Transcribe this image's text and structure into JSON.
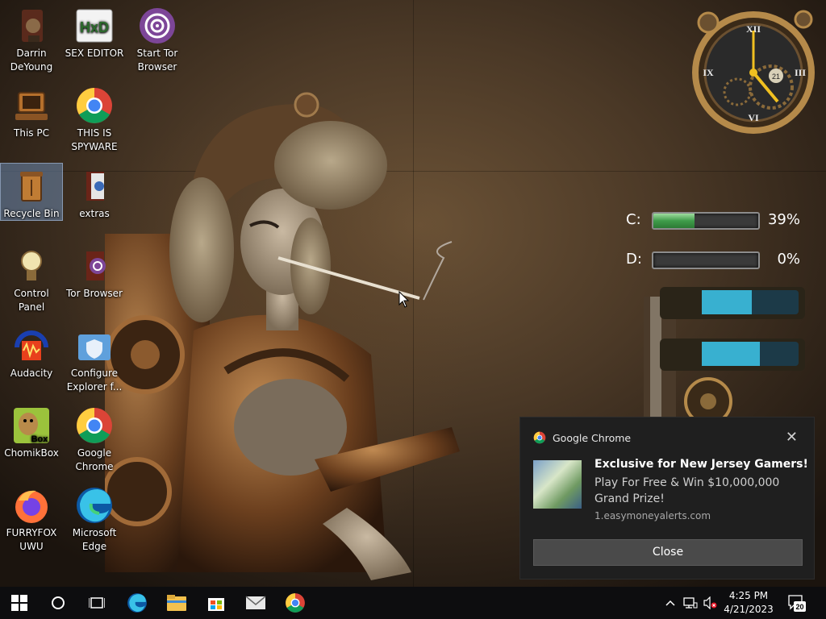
{
  "desktop": {
    "icons": [
      {
        "label": "Darrin DeYoung"
      },
      {
        "label": "SEX EDITOR"
      },
      {
        "label": "Start Tor Browser"
      },
      {
        "label": "This PC"
      },
      {
        "label": "THIS IS SPYWARE"
      },
      {
        "label": "Recycle Bin"
      },
      {
        "label": "extras"
      },
      {
        "label": "Control Panel"
      },
      {
        "label": "Tor Browser"
      },
      {
        "label": "Audacity"
      },
      {
        "label": "Configure Explorer f..."
      },
      {
        "label": "ChomikBox"
      },
      {
        "label": "Google Chrome"
      },
      {
        "label": "FURRYFOX UWU"
      },
      {
        "label": "Microsoft Edge"
      }
    ],
    "hex_icon_text": "HxD",
    "box_icon_text": "Box"
  },
  "widgets": {
    "clock": {
      "date_day": "21",
      "numerals": [
        "XII",
        "III",
        "VI",
        "IX"
      ]
    },
    "drives": [
      {
        "label": "C:",
        "percent_text": "39%",
        "fill": 0.39
      },
      {
        "label": "D:",
        "percent_text": "0%",
        "fill": 0.0
      }
    ]
  },
  "notification": {
    "app_name": "Google Chrome",
    "title": "Exclusive for New Jersey Gamers!",
    "body": "Play For Free & Win $10,000,000 Grand Prize!",
    "source": "1.easymoneyalerts.com",
    "close_button": "Close"
  },
  "taskbar": {
    "time": "4:25 PM",
    "date": "4/21/2023",
    "notification_count": "20",
    "pinned": [
      "start-icon",
      "cortana-icon",
      "task-view-icon",
      "edge-icon",
      "file-explorer-icon",
      "store-icon",
      "mail-icon",
      "chrome-icon"
    ]
  },
  "colors": {
    "accent_green": "#3f9c4a",
    "toast_bg": "#1f1f1f",
    "taskbar_bg": "#0d0d0f"
  }
}
